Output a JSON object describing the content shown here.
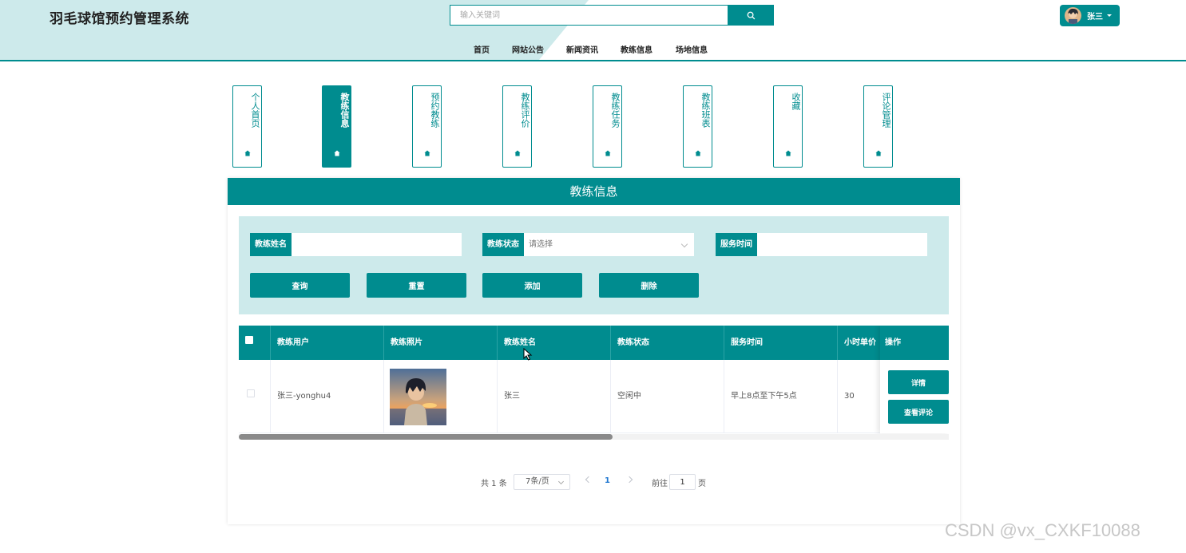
{
  "header": {
    "site_title": "羽毛球馆预约管理系统",
    "search_placeholder": "输入关键词",
    "user_name": "张三",
    "nav": [
      "首页",
      "网站公告",
      "新闻资讯",
      "教练信息",
      "场地信息"
    ]
  },
  "side_menu": {
    "active_index": 1,
    "items": [
      "个人首页",
      "教练信息",
      "预约教练",
      "教练评价",
      "教练任务",
      "教练班表",
      "收藏",
      "评论管理"
    ]
  },
  "panel": {
    "title": "教练信息",
    "filters": {
      "name_label": "教练姓名",
      "name_value": "",
      "status_label": "教练状态",
      "status_placeholder": "请选择",
      "time_label": "服务时间",
      "time_value": ""
    },
    "buttons": {
      "query": "查询",
      "reset": "重置",
      "add": "添加",
      "delete": "删除"
    }
  },
  "table": {
    "headers": [
      "教练用户",
      "教练照片",
      "教练姓名",
      "教练状态",
      "服务时间",
      "小时单价"
    ],
    "op_header": "操作",
    "rows": [
      {
        "user": "张三-yonghu4",
        "name": "张三",
        "status": "空闲中",
        "service_time": "早上8点至下午5点",
        "price": "30",
        "detail_btn": "详情",
        "comment_btn": "查看评论"
      }
    ]
  },
  "pagination": {
    "total": "共 1 条",
    "page_size": "7条/页",
    "current_page": "1",
    "goto_label": "前往",
    "goto_value": "1",
    "page_suffix": "页"
  },
  "watermark": "CSDN @vx_CXKF10088",
  "colors": {
    "primary": "#008c8f",
    "light": "#cdeaeb"
  }
}
